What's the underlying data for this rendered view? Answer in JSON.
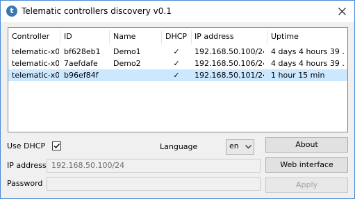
{
  "window": {
    "title": "Telematic controllers discovery v0.1",
    "app_icon_letter": "t"
  },
  "table": {
    "columns": [
      "Controller",
      "ID",
      "Name",
      "DHCP",
      "IP address",
      "Uptime"
    ],
    "rows": [
      {
        "controller": "telematic-x0",
        "id": "bf628eb1",
        "name": "Demo1",
        "dhcp": "✓",
        "ip": "192.168.50.100/24",
        "uptime": "4 days 4 hours 39 ..."
      },
      {
        "controller": "telematic-x0",
        "id": "7aefdafe",
        "name": "Demo2",
        "dhcp": "✓",
        "ip": "192.168.50.106/24",
        "uptime": "4 days 4 hours 39 ..."
      },
      {
        "controller": "telematic-x0",
        "id": "b96ef84f",
        "name": "",
        "dhcp": "✓",
        "ip": "192.168.50.101/24",
        "uptime": "1 hour 15 min"
      }
    ],
    "selected_row": 2
  },
  "form": {
    "use_dhcp_label": "Use DHCP",
    "use_dhcp_checked": true,
    "language_label": "Language",
    "language_value": "en",
    "ip_label": "IP address",
    "ip_value": "192.168.50.100/24",
    "password_label": "Password",
    "password_value": ""
  },
  "buttons": {
    "about": "About",
    "web_interface": "Web interface",
    "apply": "Apply"
  },
  "colors": {
    "selection": "#cce8ff",
    "window_border": "#4a8bd6",
    "icon_blue": "#3a76b0"
  },
  "icons": {
    "close": "close-icon",
    "checkbox": "checkmark-icon",
    "dropdown": "chevron-down-icon"
  }
}
